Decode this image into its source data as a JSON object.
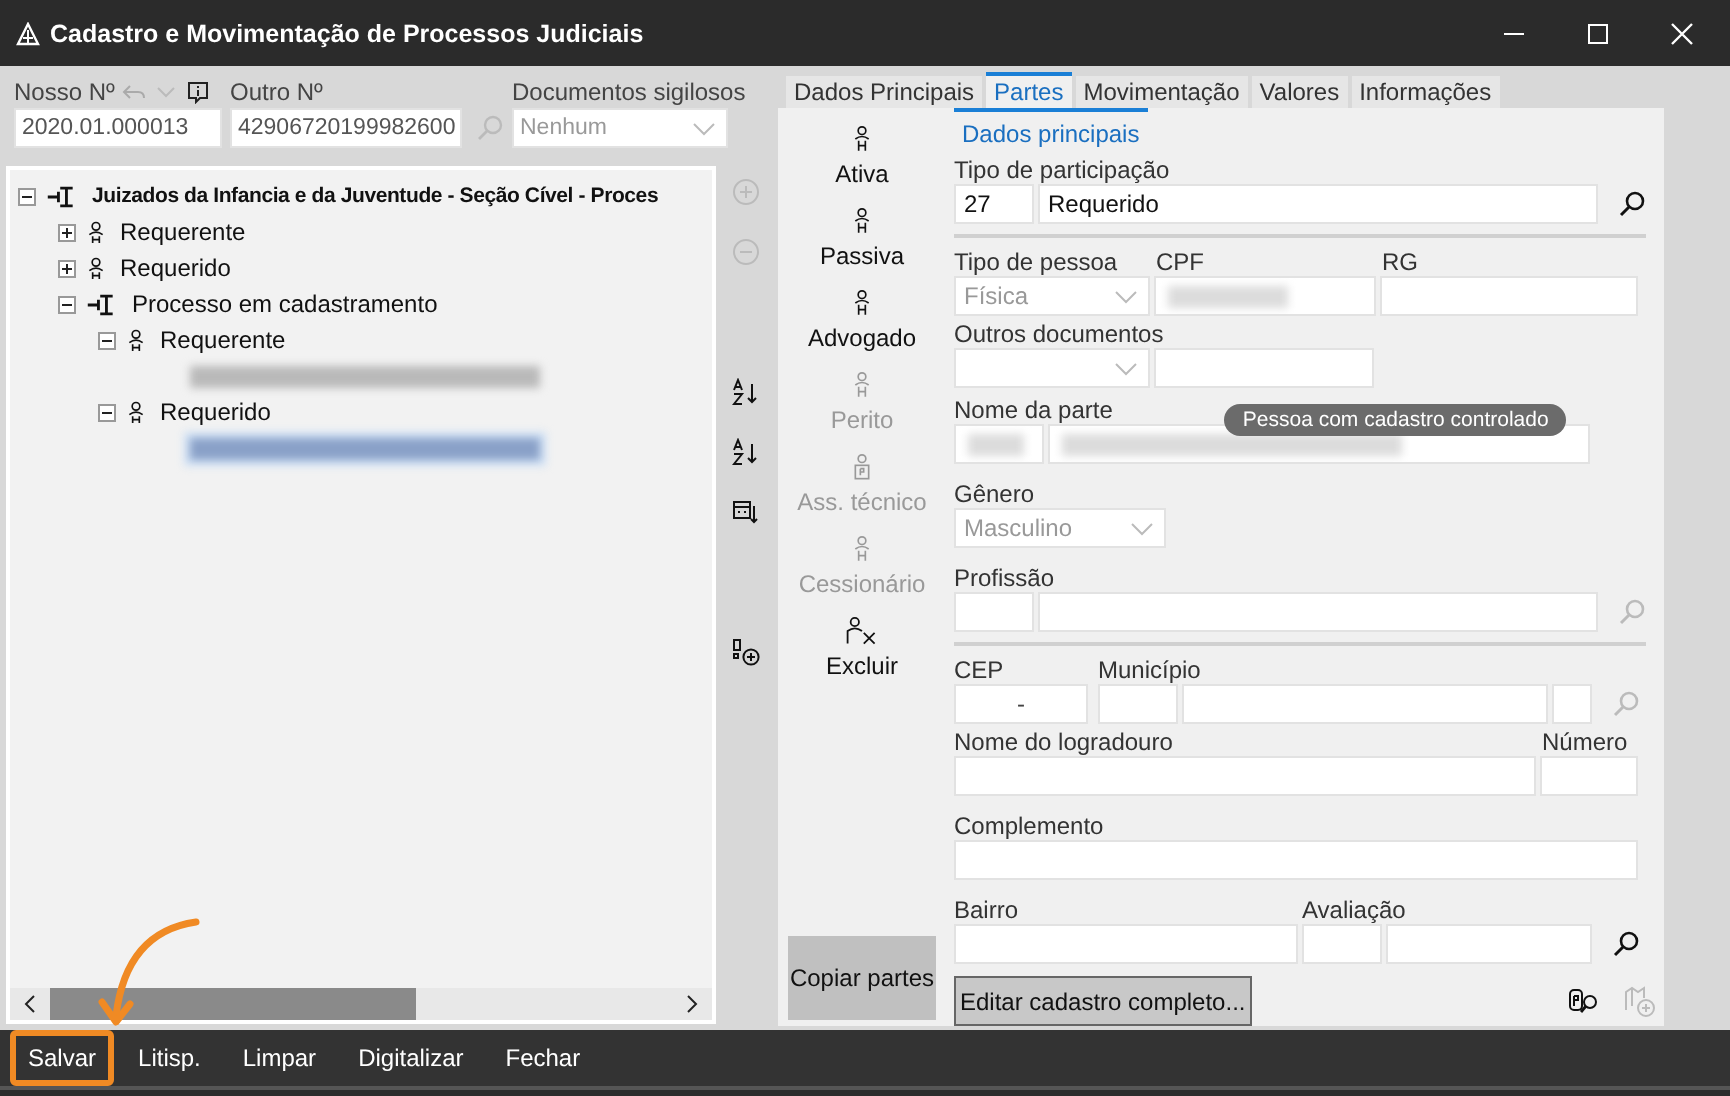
{
  "window": {
    "title": "Cadastro e Movimentação de Processos Judiciais"
  },
  "header": {
    "nosso": {
      "label": "Nosso Nº",
      "value": "2020.01.000013"
    },
    "outro": {
      "label": "Outro Nº",
      "value": "42906720199982600"
    },
    "sigilosos": {
      "label": "Documentos sigilosos",
      "value": "Nenhum"
    }
  },
  "tree": [
    {
      "label": "Juizados da Infancia e da Juventude - Seção Cível - Proces",
      "kind": "process",
      "bold": true,
      "expanded": true,
      "children": [
        {
          "label": "Requerente",
          "kind": "person",
          "expanded": false
        },
        {
          "label": "Requerido",
          "kind": "person",
          "expanded": false
        },
        {
          "label": "Processo em cadastramento",
          "kind": "process",
          "expanded": true,
          "children": [
            {
              "label": "Requerente",
              "kind": "person",
              "expanded": true,
              "children": [
                {
                  "kind": "redacted",
                  "selected": false
                }
              ]
            },
            {
              "label": "Requerido",
              "kind": "person",
              "expanded": true,
              "children": [
                {
                  "kind": "redacted",
                  "selected": true
                }
              ]
            }
          ]
        }
      ]
    }
  ],
  "tree_tools": [
    {
      "kind": "expand",
      "disabled": true
    },
    {
      "kind": "collapse",
      "disabled": true
    },
    {
      "kind": "sort-az",
      "disabled": false
    },
    {
      "kind": "sort-za",
      "disabled": false
    },
    {
      "kind": "sort-date",
      "disabled": false
    },
    {
      "kind": "add",
      "disabled": false
    }
  ],
  "tabs": [
    {
      "label": "Dados Principais",
      "selected": false
    },
    {
      "label": "Partes",
      "selected": true
    },
    {
      "label": "Movimentação",
      "selected": false
    },
    {
      "label": "Valores",
      "selected": false
    },
    {
      "label": "Informações",
      "selected": false
    }
  ],
  "roles": [
    {
      "label": "Ativa",
      "kind": "person",
      "disabled": false
    },
    {
      "label": "Passiva",
      "kind": "person",
      "disabled": false
    },
    {
      "label": "Advogado",
      "kind": "person",
      "disabled": false
    },
    {
      "label": "Perito",
      "kind": "person",
      "disabled": true
    },
    {
      "label": "Ass. técnico",
      "kind": "badge",
      "disabled": true
    },
    {
      "label": "Cessionário",
      "kind": "person",
      "disabled": true
    },
    {
      "label": "Excluir",
      "kind": "delete",
      "disabled": false
    }
  ],
  "subtab": {
    "label": "Dados principais",
    "selected": true
  },
  "form": {
    "participacao": {
      "label": "Tipo de participação",
      "code": "27",
      "value": "Requerido",
      "search_disabled": false
    },
    "pessoa": {
      "label": "Tipo de pessoa",
      "value": "Física",
      "disabled": true
    },
    "cpf": {
      "label": "CPF",
      "redacted": true
    },
    "rg": {
      "label": "RG"
    },
    "outros": {
      "label": "Outros documentos"
    },
    "nome": {
      "label": "Nome da parte",
      "redacted": true,
      "tooltip": "Pessoa com cadastro controlado"
    },
    "genero": {
      "label": "Gênero",
      "value": "Masculino"
    },
    "profissao": {
      "label": "Profissão",
      "search_disabled": true
    },
    "cep": {
      "label": "CEP",
      "value": "-"
    },
    "municipio": {
      "label": "Município",
      "search_disabled": true
    },
    "logradouro": {
      "label": "Nome do logradouro"
    },
    "numero": {
      "label": "Número"
    },
    "complemento": {
      "label": "Complemento"
    },
    "bairro": {
      "label": "Bairro"
    },
    "avaliacao": {
      "label": "Avaliação",
      "search_disabled": false
    }
  },
  "copy_button": "Copiar partes",
  "edit_button": "Editar cadastro completo...",
  "actions": [
    {
      "label": "Salvar",
      "annotated": true
    },
    {
      "label": "Litisp.",
      "annotated": false
    },
    {
      "label": "Limpar",
      "annotated": false
    },
    {
      "label": "Digitalizar",
      "annotated": false
    },
    {
      "label": "Fechar",
      "annotated": false
    }
  ]
}
